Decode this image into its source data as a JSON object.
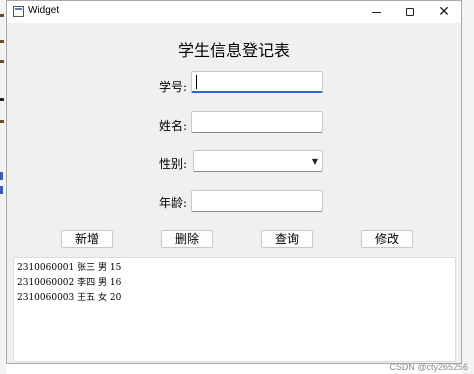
{
  "window": {
    "title": "Widget"
  },
  "form": {
    "title": "学生信息登记表",
    "fields": {
      "id_label": "学号:",
      "id_value": "",
      "name_label": "姓名:",
      "name_value": "",
      "gender_label": "性别:",
      "gender_value": "",
      "age_label": "年龄:",
      "age_value": ""
    }
  },
  "actions": {
    "add_label": "新增",
    "delete_label": "删除",
    "query_label": "查询",
    "modify_label": "修改"
  },
  "output": {
    "lines": [
      "2310060001 张三 男 15",
      "2310060002 李四 男 16",
      "2310060003 王五 女 20"
    ]
  },
  "watermark": "CSDN @cty265256",
  "colors": {
    "accent": "#1f6fc8",
    "window_bg": "#f0f0f0"
  }
}
